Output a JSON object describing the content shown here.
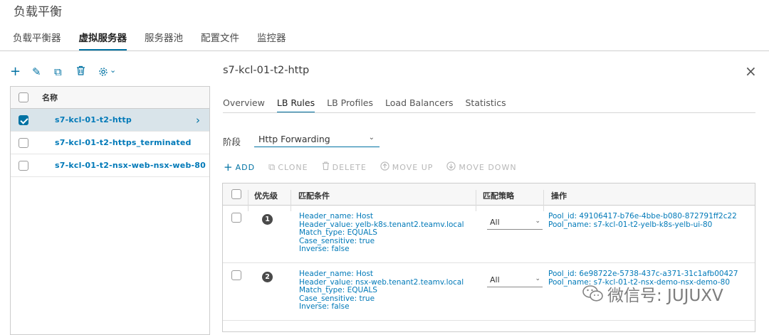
{
  "page": {
    "title": "负载平衡"
  },
  "main_tabs": [
    {
      "label": "负载平衡器"
    },
    {
      "label": "虚拟服务器"
    },
    {
      "label": "服务器池"
    },
    {
      "label": "配置文件"
    },
    {
      "label": "监控器"
    }
  ],
  "toolbar": {
    "add": "+",
    "edit": "✎",
    "clone": "⧉",
    "delete": "🗑",
    "gear_caret": "⌄"
  },
  "vs_list": {
    "header": "名称",
    "rows": [
      {
        "name": "s7-kcl-01-t2-http",
        "selected": true
      },
      {
        "name": "s7-kcl-01-t2-https_terminated",
        "selected": false
      },
      {
        "name": "s7-kcl-01-t2-nsx-web-nsx-web-80",
        "selected": false
      }
    ],
    "chevron": "›"
  },
  "detail": {
    "title": "s7-kcl-01-t2-http",
    "close": "×",
    "tabs": [
      {
        "label": "Overview"
      },
      {
        "label": "LB Rules"
      },
      {
        "label": "LB Profiles"
      },
      {
        "label": "Load Balancers"
      },
      {
        "label": "Statistics"
      }
    ],
    "phase_label": "阶段",
    "phase_value": "Http Forwarding",
    "actions": {
      "add": "ADD",
      "clone": "CLONE",
      "delete": "DELETE",
      "move_up": "MOVE UP",
      "move_down": "MOVE DOWN"
    },
    "rules_table": {
      "headers": {
        "priority": "优先级",
        "match_condition": "匹配条件",
        "match_strategy": "匹配策略",
        "action": "操作"
      },
      "rows": [
        {
          "priority": "1",
          "cond": [
            "Header_name: Host",
            "Header_value: yelb-k8s.tenant2.teamv.local",
            "Match_type: EQUALS",
            "Case_sensitive: true",
            "Inverse: false"
          ],
          "strategy": "All",
          "action": [
            "Pool_id: 49106417-b76e-4bbe-b080-872791ff2c22",
            "Pool_name: s7-kcl-01-t2-yelb-k8s-yelb-ui-80"
          ]
        },
        {
          "priority": "2",
          "cond": [
            "Header_name: Host",
            "Header_value: nsx-web.tenant2.teamv.local",
            "Match_type: EQUALS",
            "Case_sensitive: true",
            "Inverse: false"
          ],
          "strategy": "All",
          "action": [
            "Pool_id: 6e98722e-5738-437c-a371-31c1afb00427",
            "Pool_name: s7-kcl-01-t2-nsx-demo-nsx-demo-80"
          ]
        }
      ]
    }
  },
  "watermark": {
    "text": "微信号: JUJUXV"
  }
}
